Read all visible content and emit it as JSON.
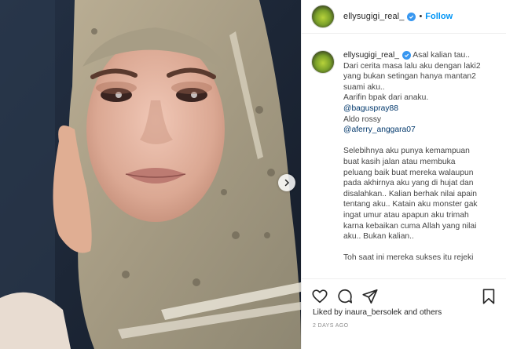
{
  "post": {
    "username": "ellysugigi_real_",
    "follow_label": "Follow",
    "separator": "•"
  },
  "caption": {
    "username": "ellysugigi_real_",
    "lines": [
      "Asal kalian tau..",
      "Dari cerita masa lalu aku dengan laki2",
      "yang bukan setingan hanya mantan2",
      "suami aku..",
      "Aarifin bpak dari anaku.",
      "@baguspray88",
      "Aldo rossy",
      "@aferry_anggara07",
      "",
      "Selebihnya aku punya kemampuan",
      "buat kasih jalan atau membuka",
      "peluang baik buat mereka walaupun",
      "pada akhirnya aku yang di hujat dan",
      "disalahkan.. Kalian berhak nilai apain",
      "tentang aku.. Katain aku monster gak",
      "ingat umur atau apapun aku trimah",
      "karna kebaikan cuma Allah yang nilai",
      "aku.. Bukan kalian..",
      "",
      "Toh saat ini mereka sukses itu rejeki"
    ],
    "first_line": "Asal kalian tau..",
    "line2": "Dari cerita masa lalu aku dengan laki2",
    "line3": "yang bukan setingan hanya mantan2",
    "line4": "suami aku..",
    "line5": "Aarifin bpak dari anaku.",
    "mention1": "@baguspray88",
    "line7": "Aldo rossy",
    "mention2": "@aferry_anggara07",
    "p2_1": "Selebihnya aku punya kemampuan",
    "p2_2": "buat kasih jalan atau membuka",
    "p2_3": "peluang baik buat mereka walaupun",
    "p2_4": "pada akhirnya aku yang di hujat dan",
    "p2_5": "disalahkan.. Kalian berhak nilai apain",
    "p2_6": "tentang aku.. Katain aku monster gak",
    "p2_7": "ingat umur atau apapun aku trimah",
    "p2_8": "karna kebaikan cuma Allah yang nilai",
    "p2_9": "aku.. Bukan kalian..",
    "p3_1": "Toh saat ini mereka sukses itu rejeki"
  },
  "actions": {
    "icons": [
      "heart-icon",
      "comment-icon",
      "share-icon",
      "bookmark-icon"
    ],
    "liked_prefix": "Liked by ",
    "liked_user": "inaura_bersolek",
    "liked_suffix": " and others",
    "timestamp": "2 DAYS AGO"
  },
  "colors": {
    "accent": "#0095f6",
    "verified": "#3897f0",
    "mention": "#00376b"
  }
}
